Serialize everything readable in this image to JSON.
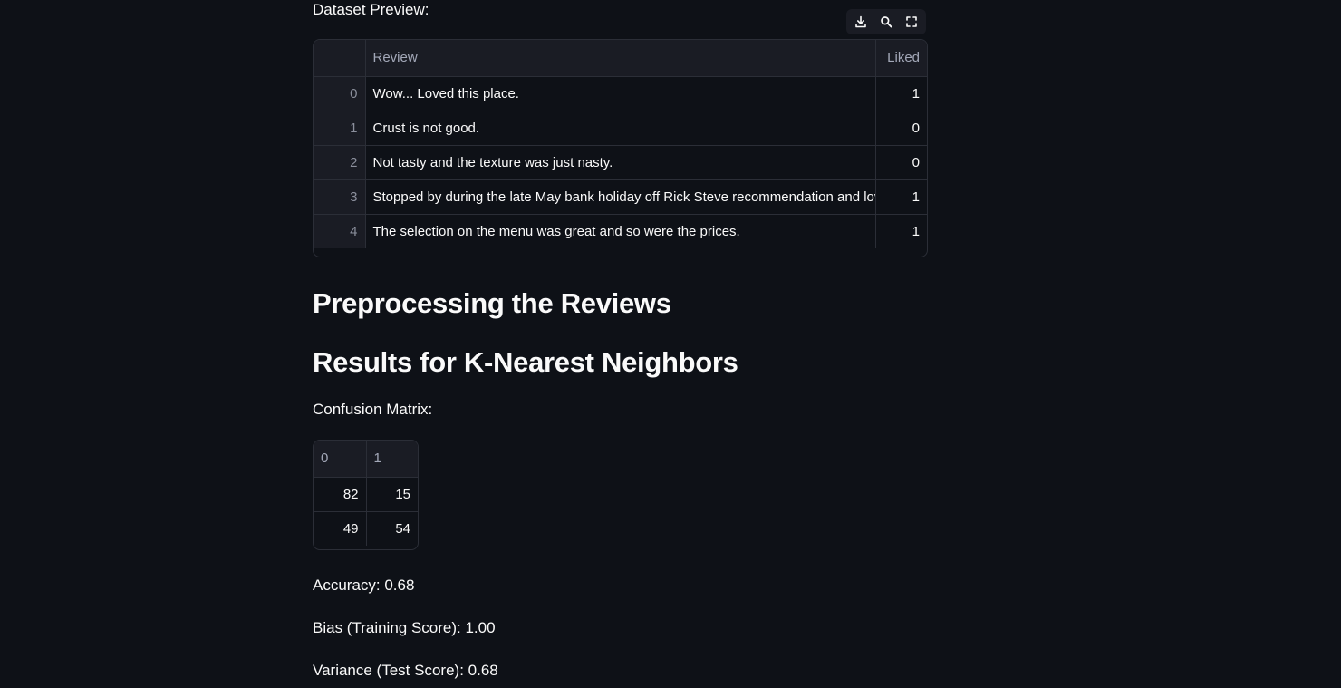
{
  "preview": {
    "caption": "Dataset Preview:",
    "toolbar": {
      "download_icon": "download-icon",
      "search_icon": "search-icon",
      "fullscreen_icon": "fullscreen-icon"
    },
    "columns": [
      "",
      "Review",
      "Liked"
    ],
    "rows": [
      {
        "index": "0",
        "review": "Wow... Loved this place.",
        "liked": "1"
      },
      {
        "index": "1",
        "review": "Crust is not good.",
        "liked": "0"
      },
      {
        "index": "2",
        "review": "Not tasty and the texture was just nasty.",
        "liked": "0"
      },
      {
        "index": "3",
        "review": "Stopped by during the late May bank holiday off Rick Steve recommendation and love",
        "liked": "1"
      },
      {
        "index": "4",
        "review": "The selection on the menu was great and so were the prices.",
        "liked": "1"
      }
    ]
  },
  "sections": {
    "preprocessing_title": "Preprocessing the Reviews",
    "results_title": "Results for K-Nearest Neighbors"
  },
  "confusion_matrix": {
    "caption": "Confusion Matrix:",
    "columns": [
      "0",
      "1"
    ],
    "rows": [
      [
        "82",
        "15"
      ],
      [
        "49",
        "54"
      ]
    ]
  },
  "metrics": {
    "accuracy": "Accuracy: 0.68",
    "bias": "Bias (Training Score): 1.00",
    "variance": "Variance (Test Score): 0.68"
  },
  "colors": {
    "background": "#0e1117",
    "header_bg": "#1a1c24",
    "border": "#2b2e37",
    "text": "#fafafa",
    "muted_text": "#a3a8b8"
  }
}
